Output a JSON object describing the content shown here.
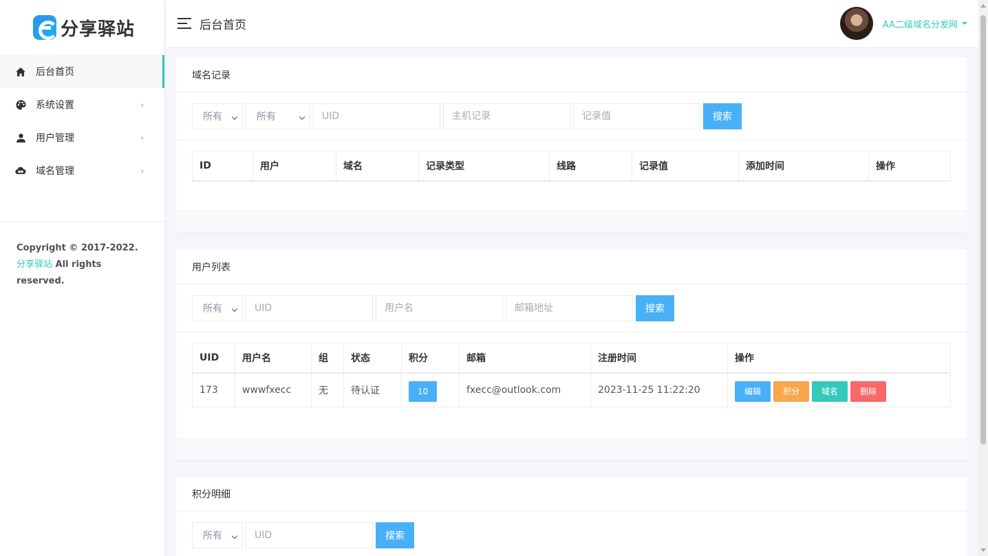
{
  "sidebar": {
    "logo_text": "分享驿站",
    "items": [
      {
        "label": "后台首页",
        "icon": "home-icon"
      },
      {
        "label": "系统设置",
        "icon": "palette-icon"
      },
      {
        "label": "用户管理",
        "icon": "user-icon"
      },
      {
        "label": "域名管理",
        "icon": "cloud-link-icon"
      }
    ],
    "copyright_prefix": "Copyright © 2017-2022. ",
    "copyright_brand": "分享驿站",
    "copyright_suffix": " All rights reserved."
  },
  "header": {
    "title": "后台首页",
    "user_name": "AA二级域名分发网"
  },
  "domain_records": {
    "title": "域名记录",
    "select1": "所有",
    "select2": "所有",
    "uid_placeholder": "UID",
    "host_placeholder": "主机记录",
    "value_placeholder": "记录值",
    "search_label": "搜索",
    "columns": [
      "ID",
      "用户",
      "域名",
      "记录类型",
      "线路",
      "记录值",
      "添加时间",
      "操作"
    ]
  },
  "user_list": {
    "title": "用户列表",
    "select1": "所有",
    "uid_placeholder": "UID",
    "username_placeholder": "用户名",
    "email_placeholder": "邮箱地址",
    "search_label": "搜索",
    "columns": [
      "UID",
      "用户名",
      "组",
      "状态",
      "积分",
      "邮箱",
      "注册时间",
      "操作"
    ],
    "rows": [
      {
        "uid": "173",
        "username": "wwwfxecc",
        "group": "无",
        "status": "待认证",
        "points": "10",
        "email": "fxecc@outlook.com",
        "registered": "2023-11-25 11:22:20"
      }
    ],
    "actions": {
      "edit": "编辑",
      "points": "积分",
      "domain": "域名",
      "delete": "删除"
    }
  },
  "points_detail": {
    "title": "积分明细",
    "select1": "所有",
    "uid_placeholder": "UID",
    "search_label": "搜索"
  },
  "colors": {
    "accent": "#33cabb",
    "primary": "#48b0f7",
    "warning": "#faa64b",
    "danger": "#f96868"
  }
}
